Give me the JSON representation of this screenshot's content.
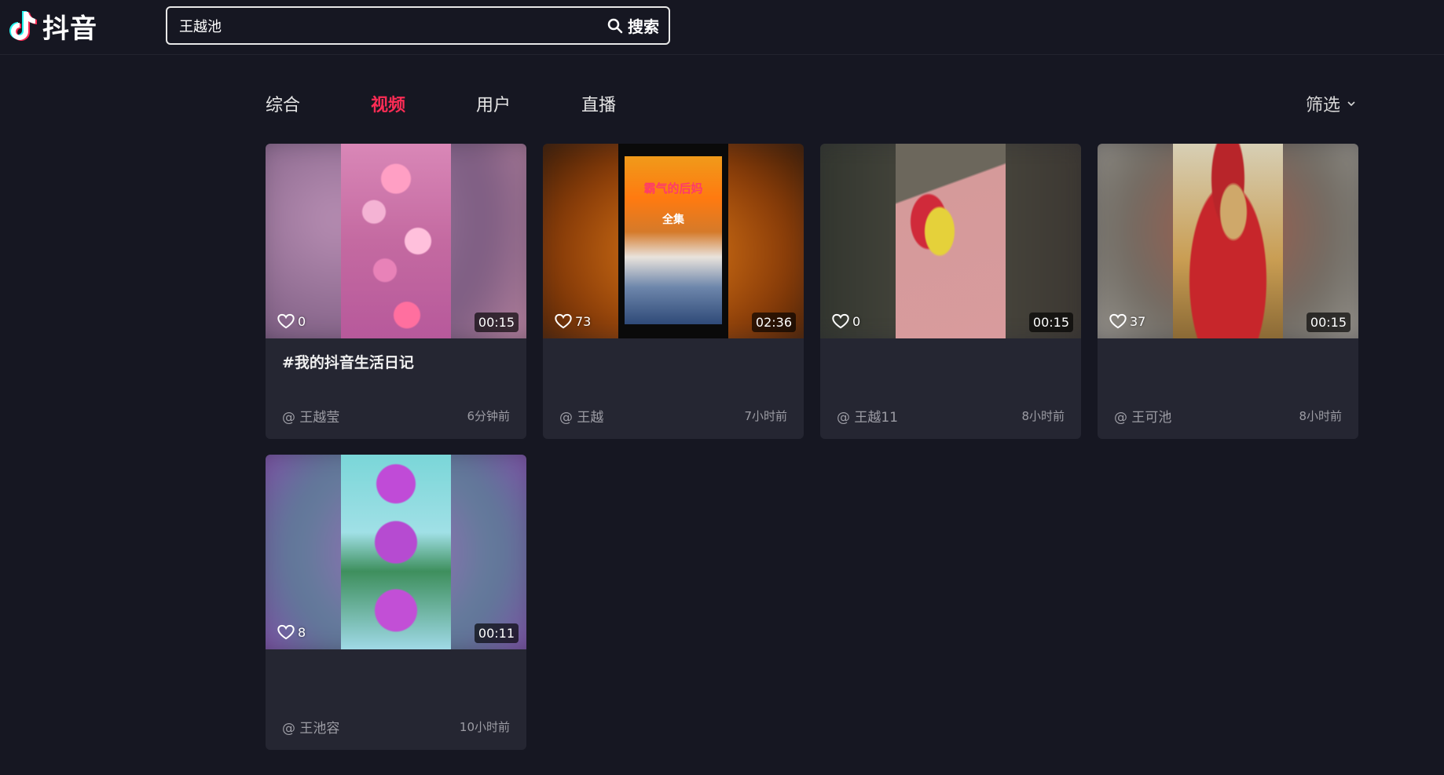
{
  "header": {
    "logo_text": "抖音",
    "search": {
      "value": "王越池",
      "button_label": "搜索"
    }
  },
  "tabs": [
    {
      "label": "综合",
      "active": false
    },
    {
      "label": "视频",
      "active": true
    },
    {
      "label": "用户",
      "active": false
    },
    {
      "label": "直播",
      "active": false
    }
  ],
  "filter_label": "筛选",
  "colors": {
    "accent": "#fe2c55",
    "background": "#161722",
    "card": "#252632"
  },
  "videos": [
    {
      "likes": "0",
      "duration": "00:15",
      "title": "#我的抖音生活日记",
      "author": "@ 王越莹",
      "time": "6分钟前"
    },
    {
      "likes": "73",
      "duration": "02:36",
      "title": "",
      "author": "@ 王越",
      "time": "7小时前",
      "cover_text": [
        "霸气的后妈",
        "全集"
      ]
    },
    {
      "likes": "0",
      "duration": "00:15",
      "title": "",
      "author": "@ 王越11",
      "time": "8小时前"
    },
    {
      "likes": "37",
      "duration": "00:15",
      "title": "",
      "author": "@ 王可池",
      "time": "8小时前"
    },
    {
      "likes": "8",
      "duration": "00:11",
      "title": "",
      "author": "@ 王池容",
      "time": "10小时前"
    }
  ]
}
